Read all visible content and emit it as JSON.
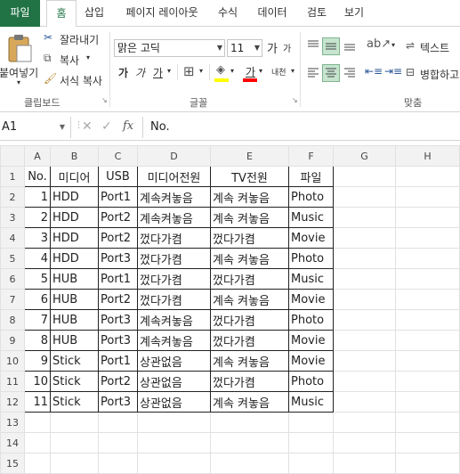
{
  "tabs": [
    "파일",
    "홈",
    "삽입",
    "페이지 레이아웃",
    "수식",
    "데이터",
    "검토",
    "보기"
  ],
  "clipboard": {
    "paste": "붙여넣기",
    "cut": "잘라내기",
    "copy": "복사",
    "format_painter": "서식 복사",
    "group": "클립보드"
  },
  "font": {
    "name": "맑은 고딕",
    "size": "11",
    "grow": "가",
    "shrink": "가",
    "bold": "가",
    "italic": "가",
    "underline": "가",
    "color_a": "가",
    "phonetic": "내천",
    "group": "글꼴"
  },
  "alignment": {
    "wrap_text": "텍스트",
    "merge": "병합하고",
    "group": "맞춤"
  },
  "formula_bar": {
    "cell_ref": "A1",
    "fx": "fx",
    "value": "No."
  },
  "columns": [
    "A",
    "B",
    "C",
    "D",
    "E",
    "F",
    "G",
    "H"
  ],
  "row_numbers": [
    "1",
    "2",
    "3",
    "4",
    "5",
    "6",
    "7",
    "8",
    "9",
    "10",
    "11",
    "12",
    "13",
    "14",
    "15"
  ],
  "header_row": [
    "No.",
    "미디어",
    "USB",
    "미디어전원",
    "TV전원",
    "파일"
  ],
  "rows": [
    [
      "1",
      "HDD",
      "Port1",
      "계속켜놓음",
      "계속 켜놓음",
      "Photo"
    ],
    [
      "2",
      "HDD",
      "Port2",
      "계속켜놓음",
      "계속 켜놓음",
      "Music"
    ],
    [
      "3",
      "HDD",
      "Port2",
      "껐다가켬",
      "껐다가켬",
      "Movie"
    ],
    [
      "4",
      "HDD",
      "Port3",
      "껐다가켬",
      "계속 켜놓음",
      "Photo"
    ],
    [
      "5",
      "HUB",
      "Port1",
      "껐다가켬",
      "껐다가켬",
      "Music"
    ],
    [
      "6",
      "HUB",
      "Port2",
      "껐다가켬",
      "계속 켜놓음",
      "Movie"
    ],
    [
      "7",
      "HUB",
      "Port3",
      "계속켜놓음",
      "껐다가켬",
      "Photo"
    ],
    [
      "8",
      "HUB",
      "Port3",
      "계속켜놓음",
      "껐다가켬",
      "Movie"
    ],
    [
      "9",
      "Stick",
      "Port1",
      "상관없음",
      "계속 켜놓음",
      "Movie"
    ],
    [
      "10",
      "Stick",
      "Port2",
      "상관없음",
      "껐다가켬",
      "Photo"
    ],
    [
      "11",
      "Stick",
      "Port3",
      "상관없음",
      "계속 켜놓음",
      "Music"
    ]
  ],
  "colors": {
    "file_tab": "#217346",
    "active_tab_text": "#217346",
    "fill_highlight": "#ffff00",
    "font_color_bar": "#ff0000"
  }
}
